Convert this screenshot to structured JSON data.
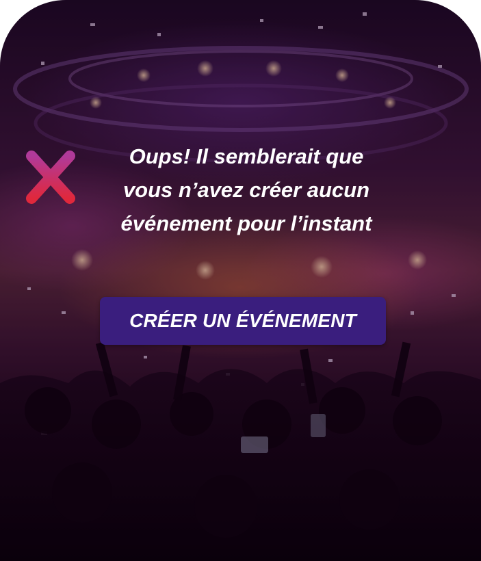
{
  "empty_state": {
    "icon": "close-x-icon",
    "message_lines": [
      "Oups! Il semblerait que",
      "vous n’avez créer aucun",
      "événement pour l’instant"
    ]
  },
  "create_button": {
    "label": "CRÉER UN ÉVÉNEMENT"
  },
  "colors": {
    "button_bg": "#3a1e7e",
    "icon_gradient_top": "#b03a9a",
    "icon_gradient_bottom": "#e0283c",
    "text": "#ffffff"
  }
}
